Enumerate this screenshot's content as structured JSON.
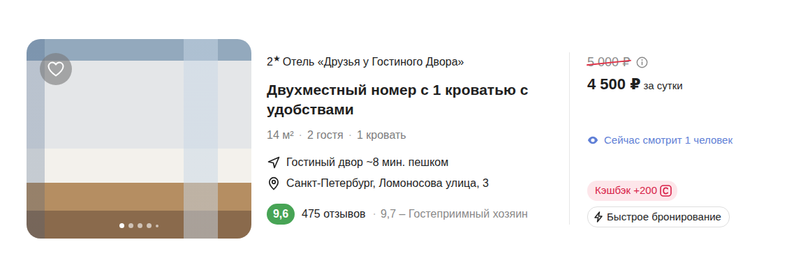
{
  "photo": {
    "favorite": false,
    "dots": [
      {
        "selected": true
      },
      {
        "selected": false
      },
      {
        "selected": false
      },
      {
        "selected": false
      },
      {
        "selected": false
      }
    ]
  },
  "hotel": {
    "stars": "2",
    "star_icon": "★",
    "name": "Отель «Друзья у Гостиного Двора»"
  },
  "room": {
    "title": "Двухместный номер с 1 кроватью с удобствами",
    "facts": [
      "14 м²",
      "2 гостя",
      "1 кровать"
    ],
    "separator": "·"
  },
  "location": {
    "distance": "Гостиный двор ~8 мин. пешком",
    "address": "Санкт-Петербург, Ломоносова улица, 3"
  },
  "rating": {
    "score": "9,6",
    "reviews": "475 отзывов",
    "separator": "·",
    "highlight": "9,7 – Гостеприимный хозяин"
  },
  "price": {
    "old": "5 000 ₽",
    "current": "4 500 ₽",
    "period": "за сутки"
  },
  "viewers": "Сейчас смотрит 1 человек",
  "cashback": "Кэшбэк +200",
  "fast_booking": "Быстрое бронирование"
}
